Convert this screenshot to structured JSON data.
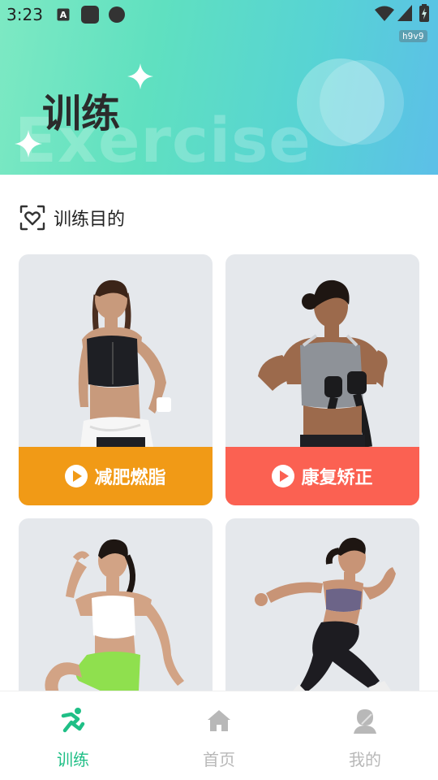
{
  "status_bar": {
    "time": "3:23",
    "debug_tag": "h9v9"
  },
  "banner": {
    "title": "训练",
    "watermark": "Exercise"
  },
  "section": {
    "title": "训练目的",
    "icon": "heart-frame-icon"
  },
  "cards": [
    {
      "label": "减肥燃脂",
      "color": "#f19a16",
      "icon": "play-icon"
    },
    {
      "label": "康复矫正",
      "color": "#fb6152",
      "icon": "play-icon"
    },
    {
      "label": "",
      "color": "#e5e8ec"
    },
    {
      "label": "",
      "color": "#e5e8ec"
    }
  ],
  "bottom_nav": {
    "items": [
      {
        "label": "训练",
        "icon": "running-icon",
        "active": true
      },
      {
        "label": "首页",
        "icon": "home-icon",
        "active": false
      },
      {
        "label": "我的",
        "icon": "profile-icon",
        "active": false
      }
    ],
    "active_color": "#1fbf86",
    "inactive_color": "#b8b8b8"
  }
}
